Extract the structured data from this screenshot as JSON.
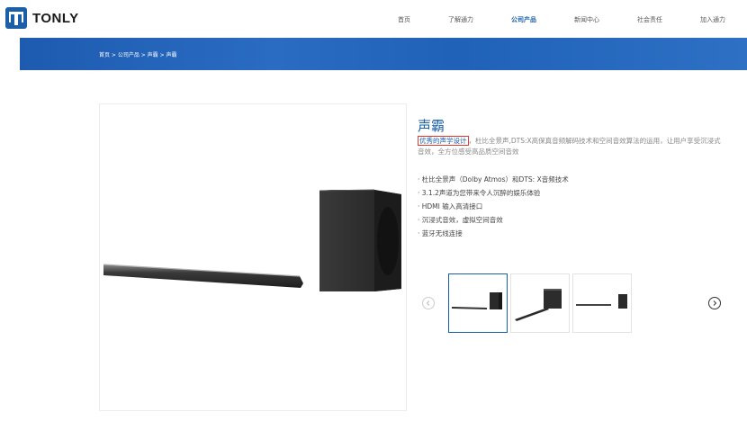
{
  "brand": {
    "name": "TONLY"
  },
  "nav": [
    {
      "label": "首页"
    },
    {
      "label": "了解通力"
    },
    {
      "label": "公司产品",
      "active": true
    },
    {
      "label": "新闻中心"
    },
    {
      "label": "社会责任"
    },
    {
      "label": "加入通力"
    }
  ],
  "breadcrumb": [
    "首页 > 公司产品 > 声霸 > 声霸"
  ],
  "product": {
    "title": "声霸",
    "desc_highlight": "优秀的声学设计",
    "desc_rest": "，杜比全景声,DTS:X高保真音频解码技术和空间音效算法的运用，让用户享受沉浸式音效，全方位感受高品质空间音效",
    "features": [
      "· 杜比全景声（Dolby Atmos）和DTS: X音频技术",
      "· 3.1.2声道为您带来令人沉醉的娱乐体验",
      "· HDMI 输入高清接口",
      "· 沉浸式音效，虚拟空间音效",
      "· 蓝牙无线连接"
    ]
  },
  "colors": {
    "brand_blue": "#1b5fa8",
    "highlight_red": "#e23a2e"
  },
  "icons": {
    "prev": "chevron-left-icon",
    "next": "chevron-right-icon"
  }
}
